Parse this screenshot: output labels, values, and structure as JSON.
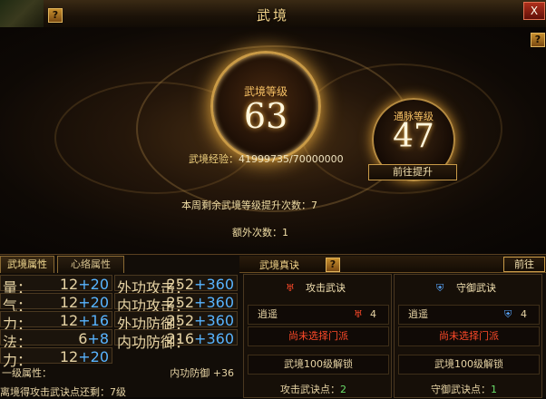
{
  "window": {
    "title": "武境",
    "help_glyph": "?",
    "close_glyph": "X"
  },
  "scene": {
    "main_level_label": "武境等级",
    "main_level_value": "63",
    "side_level_label": "通脉等级",
    "side_level_value": "47",
    "exp_label": "武境经验：",
    "exp_value": "41999735/70000000",
    "goto_upgrade_button": "前往提升",
    "weekly_remaining": "本周剩余武境等级提升次数：7",
    "extra_count": "额外次数：1"
  },
  "tabs": {
    "wujing": "武境属性",
    "xinluo": "心络属性"
  },
  "attributes": [
    {
      "label": "量：",
      "base": "12",
      "bonus": "+20"
    },
    {
      "label": "气：",
      "base": "12",
      "bonus": "+20"
    },
    {
      "label": "力：",
      "base": "12",
      "bonus": "+16"
    },
    {
      "label": "法：",
      "base": "6",
      "bonus": "+8"
    },
    {
      "label": "力：",
      "base": "12",
      "bonus": "+20"
    }
  ],
  "attributes_right": [
    {
      "label": "外功攻击：",
      "base": "252",
      "bonus": "+360"
    },
    {
      "label": "内功攻击：",
      "base": "252",
      "bonus": "+360"
    },
    {
      "label": "外功防御：",
      "base": "252",
      "bonus": "+360"
    },
    {
      "label": "内功防御：",
      "base": "216",
      "bonus": "+360"
    }
  ],
  "attr_summary": {
    "label": "一级属性：",
    "value": "内功防御 +36"
  },
  "attr_bottom": "离境得攻击武诀点还剩：7级",
  "zhenjue": {
    "title": "武境真诀",
    "goto_button": "前往"
  },
  "columns": {
    "attack": {
      "title": "攻击武诀",
      "school": "逍遥",
      "count": "4",
      "unselected": "尚未选择门派",
      "unlock": "武境100级解锁",
      "points": "攻击武诀点：",
      "points_value": "2"
    },
    "defense": {
      "title": "守御武诀",
      "school": "逍遥",
      "count": "4",
      "unselected": "尚未选择门派",
      "unlock": "武境100级解锁",
      "points": "守御武诀点：",
      "points_value": "1"
    }
  },
  "colors": {
    "accent": "#f0b040",
    "bonus_blue": "#58b4ff",
    "warning_red": "#ff4a2a"
  }
}
